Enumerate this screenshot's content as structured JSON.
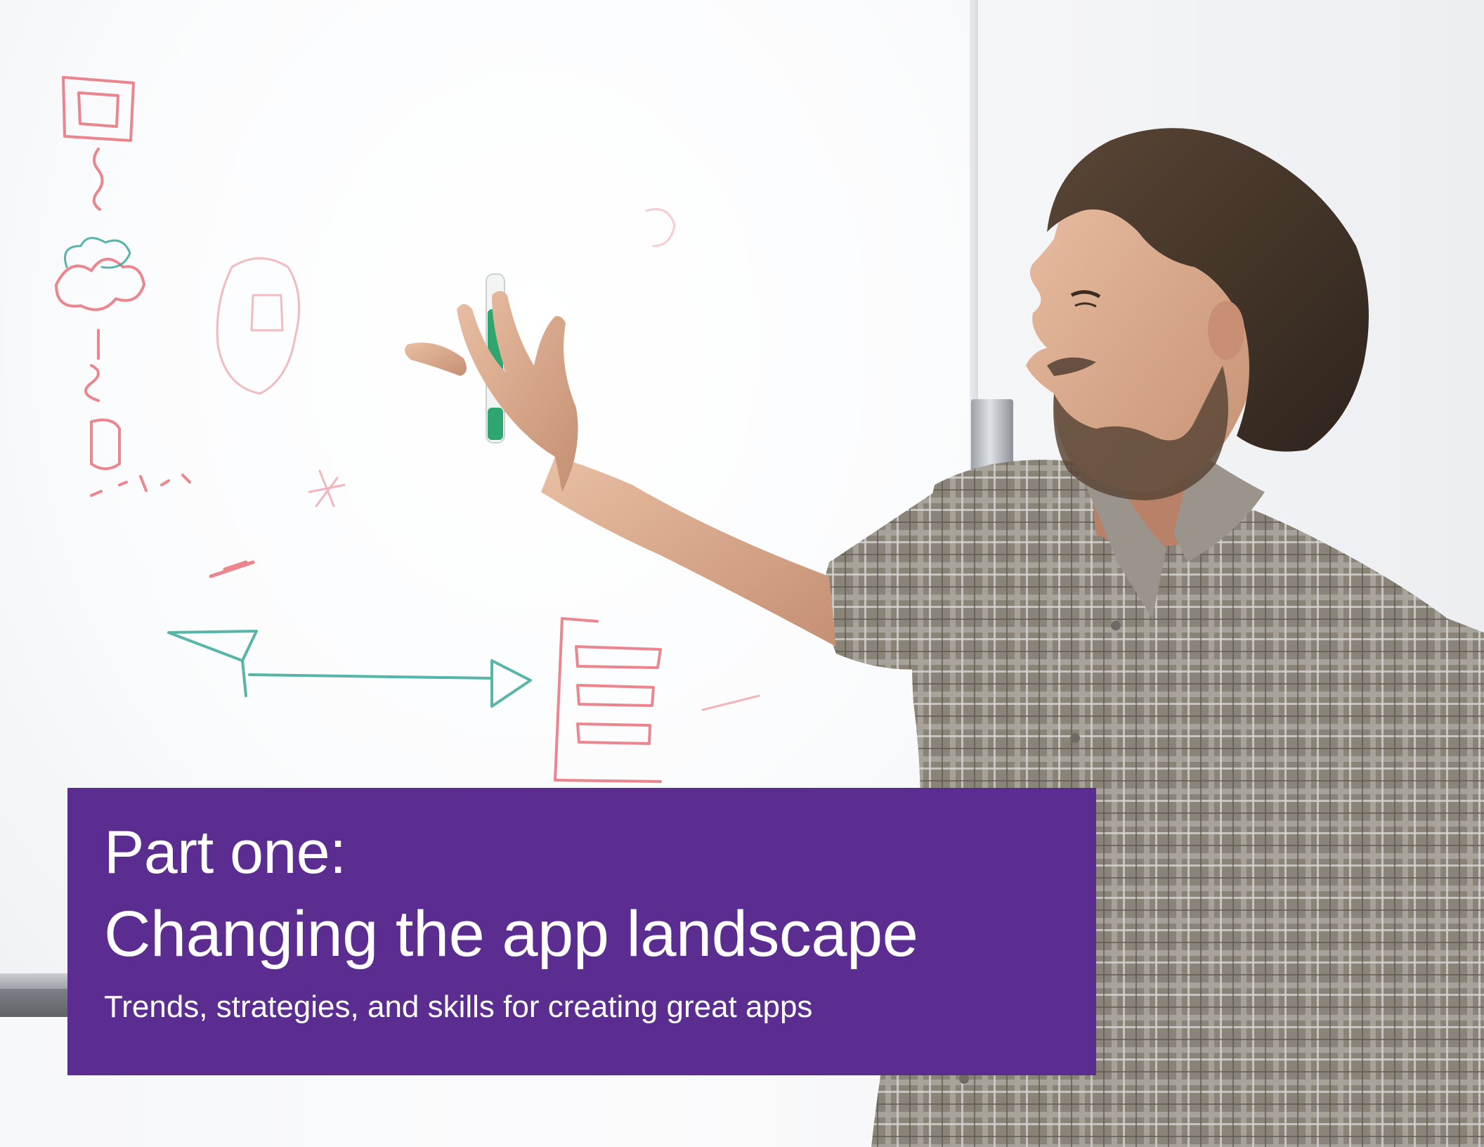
{
  "cover": {
    "kicker": "Part one:",
    "headline": "Changing the app landscape",
    "subtitle": "Trends, strategies, and skills for creating great apps"
  },
  "colors": {
    "title_block": "#5c2d91",
    "title_text": "#ffffff",
    "marker_red": "#e8707a",
    "marker_teal": "#3aa89a"
  }
}
